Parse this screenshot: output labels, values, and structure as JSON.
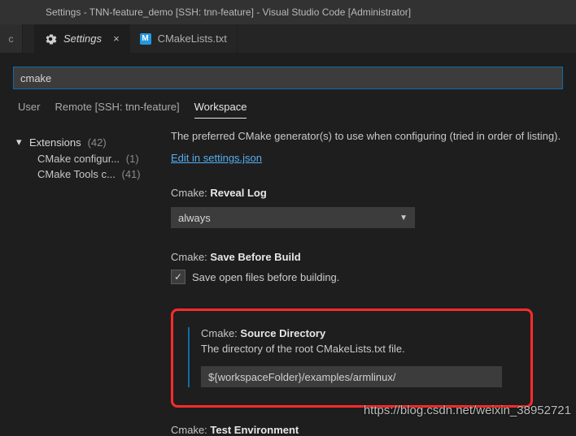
{
  "window_title": "Settings - TNN-feature_demo [SSH: tnn-feature] - Visual Studio Code [Administrator]",
  "tabs": {
    "stub": "c",
    "active": {
      "label": "Settings"
    },
    "second": {
      "icon_letter": "M",
      "label": "CMakeLists.txt"
    }
  },
  "search": {
    "value": "cmake"
  },
  "scope": {
    "user": "User",
    "remote": "Remote [SSH: tnn-feature]",
    "workspace": "Workspace"
  },
  "sidebar": {
    "heading": {
      "label": "Extensions",
      "count": "(42)"
    },
    "children": [
      {
        "label": "CMake configur...",
        "count": "(1)"
      },
      {
        "label": "CMake Tools c...",
        "count": "(41)"
      }
    ]
  },
  "settings": {
    "generators_desc": "The preferred CMake generator(s) to use when configuring (tried in order of listing).",
    "edit_link": "Edit in settings.json",
    "reveal_log": {
      "key": "Cmake:",
      "name": "Reveal Log",
      "value": "always"
    },
    "save_before_build": {
      "key": "Cmake:",
      "name": "Save Before Build",
      "desc": "Save open files before building."
    },
    "source_dir": {
      "key": "Cmake:",
      "name": "Source Directory",
      "desc": "The directory of the root CMakeLists.txt file.",
      "value": "${workspaceFolder}/examples/armlinux/"
    },
    "test_env": {
      "key": "Cmake:",
      "name": "Test Environment"
    }
  },
  "watermark": "https://blog.csdn.net/weixin_38952721"
}
